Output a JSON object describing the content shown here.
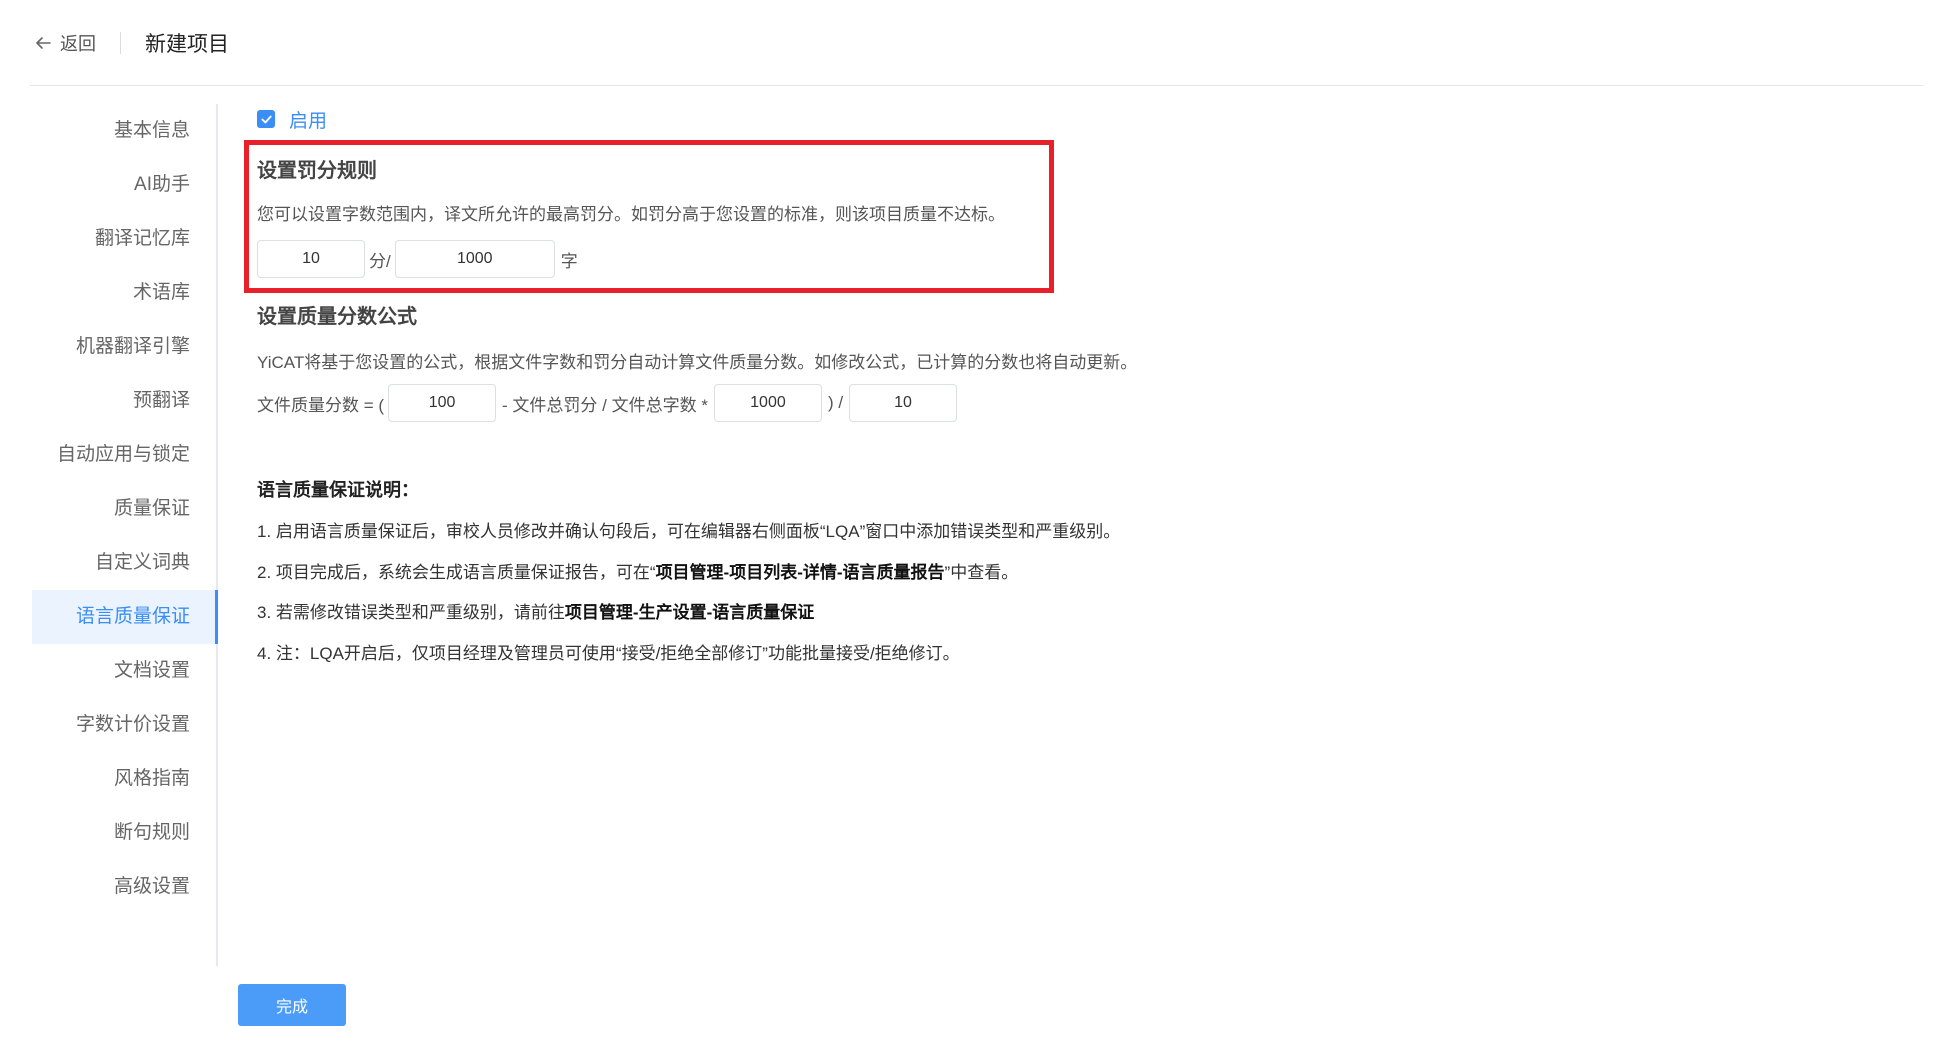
{
  "header": {
    "back_label": "返回",
    "title": "新建项目"
  },
  "sidebar": {
    "items": [
      {
        "label": "基本信息"
      },
      {
        "label": "AI助手"
      },
      {
        "label": "翻译记忆库"
      },
      {
        "label": "术语库"
      },
      {
        "label": "机器翻译引擎"
      },
      {
        "label": "预翻译"
      },
      {
        "label": "自动应用与锁定"
      },
      {
        "label": "质量保证"
      },
      {
        "label": "自定义词典"
      },
      {
        "label": "语言质量保证",
        "active": true
      },
      {
        "label": "文档设置"
      },
      {
        "label": "字数计价设置"
      },
      {
        "label": "风格指南"
      },
      {
        "label": "断句规则"
      },
      {
        "label": "高级设置"
      }
    ]
  },
  "main": {
    "enable_label": "启用",
    "penalty": {
      "title": "设置罚分规则",
      "desc": "您可以设置字数范围内，译文所允许的最高罚分。如罚分高于您设置的标准，则该项目质量不达标。",
      "score_value": "10",
      "score_unit": "分/",
      "words_value": "1000",
      "words_unit": "字"
    },
    "formula": {
      "title": "设置质量分数公式",
      "desc": "YiCAT将基于您设置的公式，根据文件字数和罚分自动计算文件质量分数。如修改公式，已计算的分数也将自动更新。",
      "prefix": "文件质量分数 = (",
      "base_value": "100",
      "middle": "- 文件总罚分 / 文件总字数 *",
      "multiplier_value": "1000",
      "close": ") /",
      "divisor_value": "10"
    },
    "lqa": {
      "title": "语言质量保证说明：",
      "line1": "1. 启用语言质量保证后，审校人员修改并确认句段后，可在编辑器右侧面板“LQA”窗口中添加错误类型和严重级别。",
      "line2_pre": "2. 项目完成后，系统会生成语言质量保证报告，可在“",
      "line2_bold": "项目管理-项目列表-详情-语言质量报告",
      "line2_post": "”中查看。",
      "line3_pre": "3. 若需修改错误类型和严重级别，请前往",
      "line3_bold": "项目管理-生产设置-语言质量保证",
      "line4": "4. 注：LQA开启后，仅项目经理及管理员可使用“接受/拒绝全部修订”功能批量接受/拒绝修订。"
    }
  },
  "footer": {
    "done_label": "完成"
  }
}
